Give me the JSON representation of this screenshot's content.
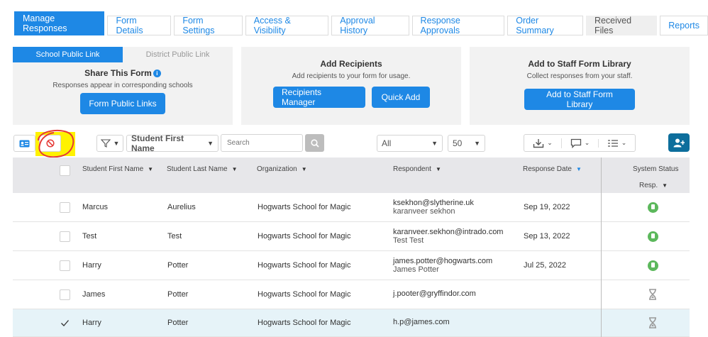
{
  "tabs": [
    {
      "label": "Manage Responses"
    },
    {
      "label": "Form Details"
    },
    {
      "label": "Form Settings"
    },
    {
      "label": "Access & Visibility"
    },
    {
      "label": "Approval History"
    },
    {
      "label": "Response Approvals"
    },
    {
      "label": "Order Summary"
    },
    {
      "label": "Received Files"
    },
    {
      "label": "Reports"
    }
  ],
  "share_panel": {
    "subtab_school": "School Public Link",
    "subtab_district": "District Public Link",
    "title": "Share This Form",
    "subtitle": "Responses appear in corresponding schools",
    "button": "Form Public Links"
  },
  "recipients_panel": {
    "title": "Add Recipients",
    "subtitle": "Add recipients to your form for usage.",
    "button_manager": "Recipients Manager",
    "button_quick": "Quick Add"
  },
  "library_panel": {
    "title": "Add to Staff Form Library",
    "subtitle": "Collect responses from your staff.",
    "button": "Add to Staff Form Library"
  },
  "toolbar": {
    "filter_field": "Student First Name",
    "search_placeholder": "Search",
    "status_filter": "All",
    "page_size": "50"
  },
  "table": {
    "headers": {
      "first_name": "Student First Name",
      "last_name": "Student Last Name",
      "organization": "Organization",
      "respondent": "Respondent",
      "response_date": "Response Date",
      "system_status": "System Status",
      "resp": "Resp."
    },
    "rows": [
      {
        "first": "Marcus",
        "last": "Aurelius",
        "org": "Hogwarts School for Magic",
        "email": "ksekhon@slytherine.uk",
        "name": "karanveer sekhon",
        "date": "Sep 19, 2022",
        "status": "complete",
        "checked": false
      },
      {
        "first": "Test",
        "last": "Test",
        "org": "Hogwarts School for Magic",
        "email": "karanveer.sekhon@intrado.com",
        "name": "Test Test",
        "date": "Sep 13, 2022",
        "status": "complete",
        "checked": false
      },
      {
        "first": "Harry",
        "last": "Potter",
        "org": "Hogwarts School for Magic",
        "email": "james.potter@hogwarts.com",
        "name": "James Potter",
        "date": "Jul 25, 2022",
        "status": "complete",
        "checked": false
      },
      {
        "first": "James",
        "last": "Potter",
        "org": "Hogwarts School for Magic",
        "email": "j.pooter@gryffindor.com",
        "name": "",
        "date": "",
        "status": "pending",
        "checked": false
      },
      {
        "first": "Harry",
        "last": "Potter",
        "org": "Hogwarts School for Magic",
        "email": "h.p@james.com",
        "name": "",
        "date": "",
        "status": "pending",
        "checked": true
      }
    ]
  },
  "colors": {
    "accent": "#1e88e5",
    "success": "#5cb85c",
    "highlight": "#fff200",
    "annotation": "#e53935"
  }
}
